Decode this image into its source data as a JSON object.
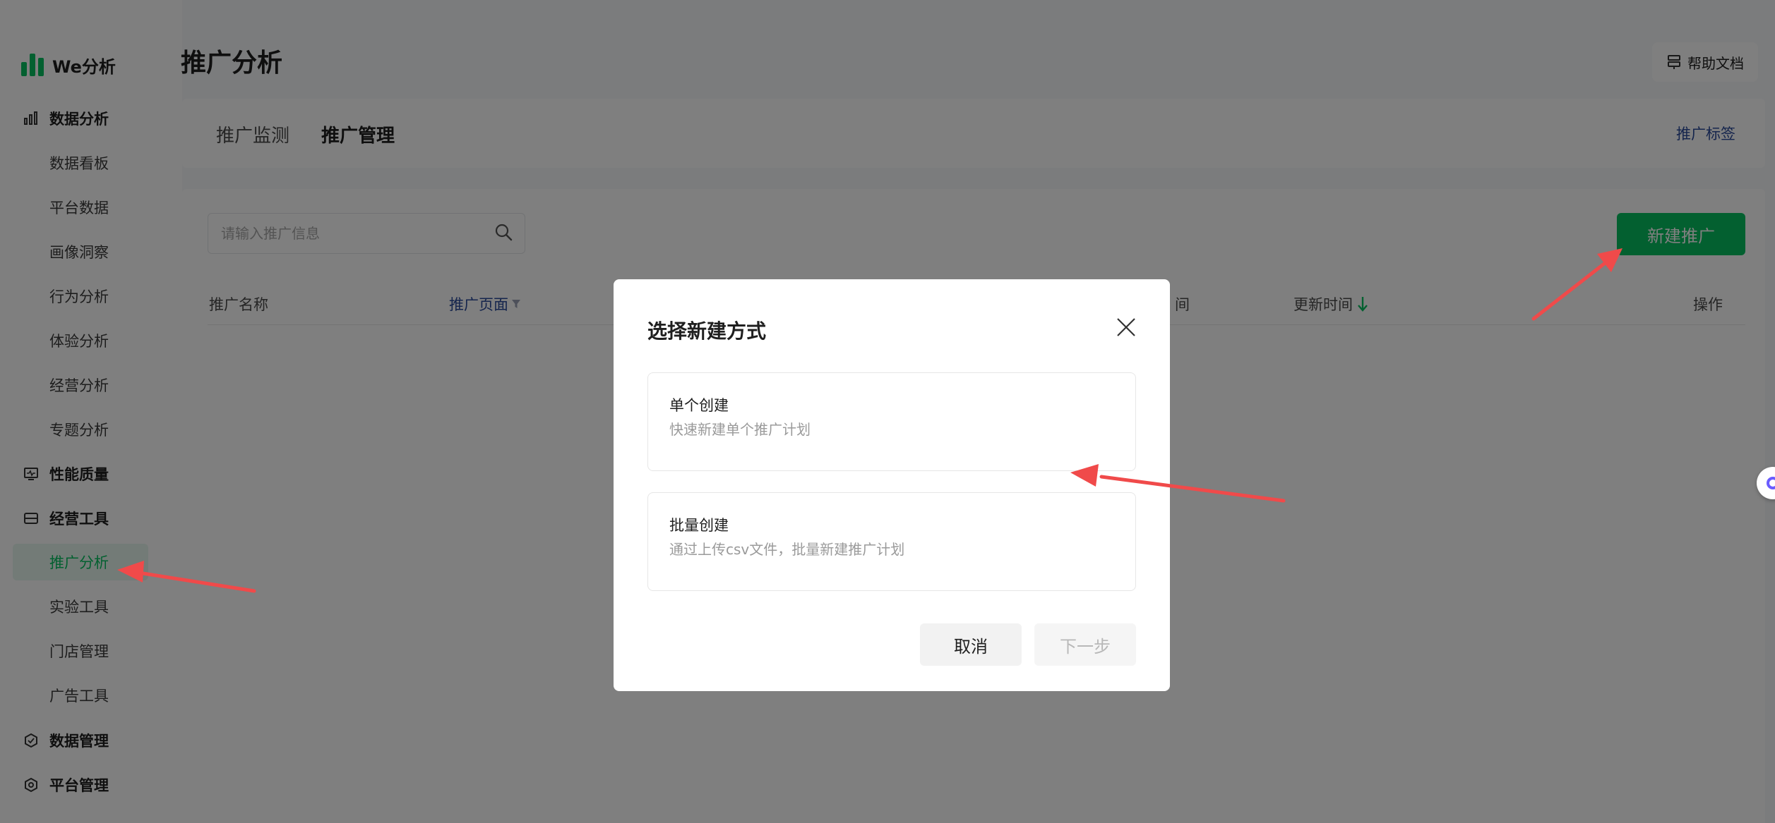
{
  "app": {
    "name": "We分析",
    "logo_icon": "bar-logo-icon",
    "brand_color": "#07c160"
  },
  "sidebar": {
    "groups": [
      {
        "label": "数据分析",
        "icon": "bar-chart-icon"
      },
      {
        "label": "性能质量",
        "icon": "monitor-icon"
      },
      {
        "label": "经营工具",
        "icon": "inbox-icon"
      },
      {
        "label": "数据管理",
        "icon": "hexagon-check-icon"
      },
      {
        "label": "平台管理",
        "icon": "hexagon-gear-icon"
      }
    ],
    "data_items": [
      "数据看板",
      "平台数据",
      "画像洞察",
      "行为分析",
      "体验分析",
      "经营分析",
      "专题分析"
    ],
    "tool_items": [
      "推广分析",
      "实验工具",
      "门店管理",
      "广告工具"
    ],
    "active_item": "推广分析"
  },
  "header": {
    "title": "推广分析",
    "help_label": "帮助文档",
    "help_icon": "document-icon"
  },
  "tabs": {
    "items": [
      "推广监测",
      "推广管理"
    ],
    "selected": "推广管理",
    "right_link": "推广标签"
  },
  "toolbar": {
    "search_placeholder": "请输入推广信息",
    "search_value": "",
    "new_button": "新建推广"
  },
  "table": {
    "columns": {
      "name": "推广名称",
      "page": "推广页面",
      "created_partial": "间",
      "updated": "更新时间",
      "action": "操作"
    },
    "sort_direction": "descending"
  },
  "modal": {
    "title": "选择新建方式",
    "options": [
      {
        "title": "单个创建",
        "desc": "快速新建单个推广计划"
      },
      {
        "title": "批量创建",
        "desc": "通过上传csv文件，批量新建推广计划"
      }
    ],
    "cancel_label": "取消",
    "next_label": "下一步",
    "next_enabled": false
  },
  "annotation": {
    "arrow_color": "#f04a4a"
  }
}
